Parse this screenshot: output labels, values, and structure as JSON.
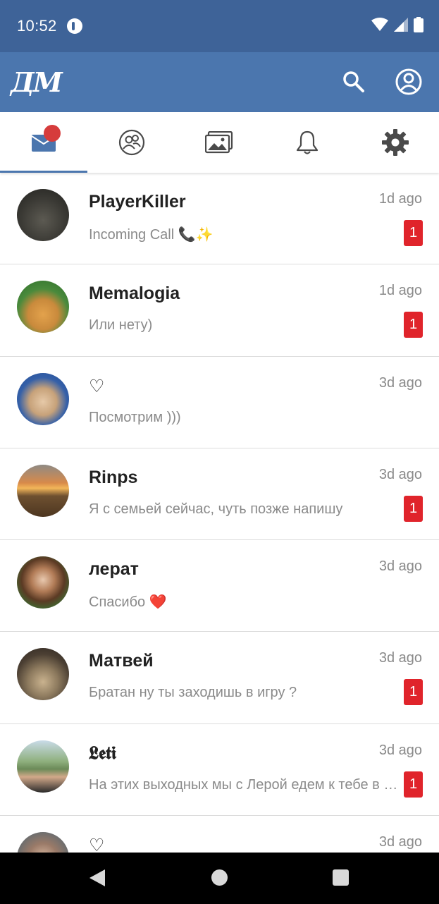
{
  "status_bar": {
    "time": "10:52",
    "icons": [
      "app-notification-icon",
      "wifi-icon",
      "cellular-signal-icon",
      "battery-icon"
    ]
  },
  "app_bar": {
    "logo_text": "ДМ",
    "actions": [
      "search-icon",
      "account-icon"
    ]
  },
  "tabs": [
    {
      "name": "messages",
      "icon": "envelope-icon",
      "active": true,
      "has_notification_dot": true
    },
    {
      "name": "friends",
      "icon": "people-icon",
      "active": false
    },
    {
      "name": "photos",
      "icon": "photos-icon",
      "active": false
    },
    {
      "name": "notifications",
      "icon": "bell-icon",
      "active": false
    },
    {
      "name": "settings",
      "icon": "gear-icon",
      "active": false
    }
  ],
  "chats": [
    {
      "name": "PlayerKiller",
      "preview": "Incoming Call 📞✨",
      "time": "1d ago",
      "unread": "1"
    },
    {
      "name": "Memalogia",
      "preview": "Или нету)",
      "time": "1d ago",
      "unread": "1"
    },
    {
      "name": "♡",
      "preview": "Посмотрим )))",
      "time": "3d ago",
      "unread": ""
    },
    {
      "name": "Rinps",
      "preview": "Я с семьей сейчас, чуть позже напишу",
      "time": "3d ago",
      "unread": "1"
    },
    {
      "name": "лерат",
      "preview": "Спасибо ❤️",
      "time": "3d ago",
      "unread": ""
    },
    {
      "name": "Матвей",
      "preview": "Братан ну ты заходишь в игру ?",
      "time": "3d ago",
      "unread": "1"
    },
    {
      "name": "𝕷𝖊𝖙𝖎",
      "preview": "На этих выходных мы с Лерой едем к тебе в гости",
      "time": "3d ago",
      "unread": "1"
    },
    {
      "name": "♡",
      "preview": "",
      "time": "3d ago",
      "unread": ""
    }
  ],
  "colors": {
    "status_bar": "#3e6398",
    "app_bar": "#4b76ae",
    "badge": "#e0242b",
    "notification_dot": "#d63c3c"
  }
}
